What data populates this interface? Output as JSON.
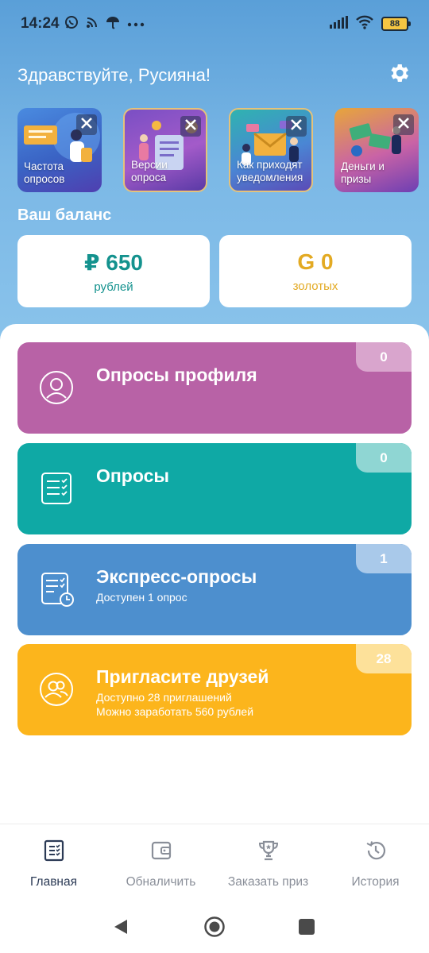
{
  "status_bar": {
    "time": "14:24",
    "battery": "88",
    "left_icons": [
      "whatsapp-icon",
      "cast-icon",
      "umbrella-icon",
      "more-icon"
    ],
    "right_icons": [
      "signal-icon",
      "wifi-icon",
      "battery-icon"
    ]
  },
  "header": {
    "greeting": "Здравствуйте, Русияна!",
    "settings_icon": "gear-icon"
  },
  "stories": [
    {
      "label": "Частота опросов"
    },
    {
      "label": "Версии опроса"
    },
    {
      "label": "Как приходят уведомления"
    },
    {
      "label": "Деньги и призы"
    }
  ],
  "balance": {
    "title": "Ваш баланс",
    "rub_value": "₽ 650",
    "rub_unit": "рублей",
    "gold_value": "G 0",
    "gold_unit": "золотых"
  },
  "cards": {
    "profile": {
      "title": "Опросы профиля",
      "badge": "0",
      "icon": "user-circle-icon"
    },
    "surveys": {
      "title": "Опросы",
      "badge": "0",
      "icon": "checklist-icon"
    },
    "express": {
      "title": "Экспресс-опросы",
      "subtitle": "Доступен 1 опрос",
      "badge": "1",
      "icon": "checklist-clock-icon"
    },
    "invite": {
      "title": "Пригласите друзей",
      "subtitle_1": "Доступно 28 приглашений",
      "subtitle_2": "Можно заработать 560 рублей",
      "badge": "28",
      "icon": "users-circle-icon"
    }
  },
  "bottom_nav": [
    {
      "label": "Главная",
      "icon": "home-checklist-icon",
      "active": true
    },
    {
      "label": "Обналичить",
      "icon": "wallet-icon",
      "active": false
    },
    {
      "label": "Заказать приз",
      "icon": "trophy-icon",
      "active": false
    },
    {
      "label": "История",
      "icon": "history-icon",
      "active": false
    }
  ],
  "colors": {
    "profile": "#b862a6",
    "surveys": "#0fa9a5",
    "express": "#4d8fce",
    "invite": "#fcb51c",
    "rub": "#14928e",
    "gold": "#e3aa23"
  }
}
